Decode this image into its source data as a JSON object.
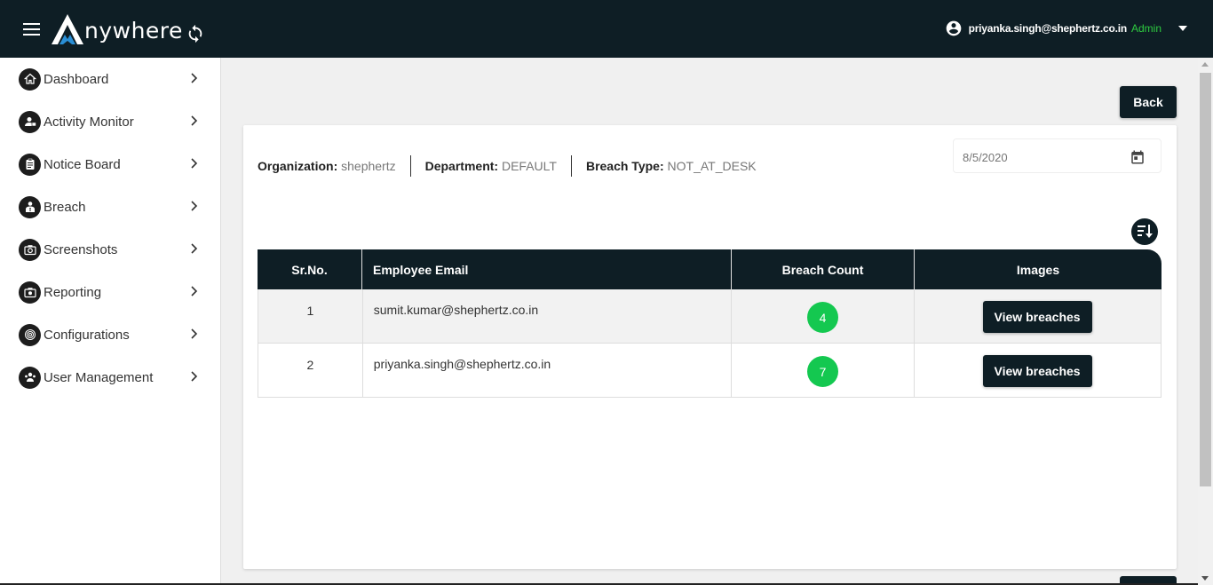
{
  "header": {
    "logo_text": "nywhere",
    "user_email": "priyanka.singh@shephertz.co.in",
    "user_role": "Admin"
  },
  "sidebar": {
    "items": [
      {
        "label": "Dashboard",
        "icon": "home-icon"
      },
      {
        "label": "Activity Monitor",
        "icon": "user-monitor-icon"
      },
      {
        "label": "Notice Board",
        "icon": "clipboard-icon"
      },
      {
        "label": "Breach",
        "icon": "person-alert-icon"
      },
      {
        "label": "Screenshots",
        "icon": "camera-icon"
      },
      {
        "label": "Reporting",
        "icon": "report-camera-icon"
      },
      {
        "label": "Configurations",
        "icon": "fingerprint-icon"
      },
      {
        "label": "User Management",
        "icon": "user-group-icon"
      }
    ]
  },
  "main": {
    "back_label": "Back",
    "info": {
      "organization_key": "Organization",
      "organization_val": "shephertz",
      "department_key": "Department",
      "department_val": "DEFAULT",
      "breach_type_key": "Breach Type",
      "breach_type_val": "NOT_AT_DESK"
    },
    "date_placeholder": "8/5/2020",
    "table": {
      "headers": [
        "Sr.No.",
        "Employee Email",
        "Breach Count",
        "Images"
      ],
      "rows": [
        {
          "sr": "1",
          "email": "sumit.kumar@shephertz.co.in",
          "count": "4",
          "action": "View breaches"
        },
        {
          "sr": "2",
          "email": "priyanka.singh@shephertz.co.in",
          "count": "7",
          "action": "View breaches"
        }
      ]
    }
  },
  "colors": {
    "header_bg": "#0e1e25",
    "accent_green": "#14c850",
    "role_green": "#2ecc40"
  }
}
